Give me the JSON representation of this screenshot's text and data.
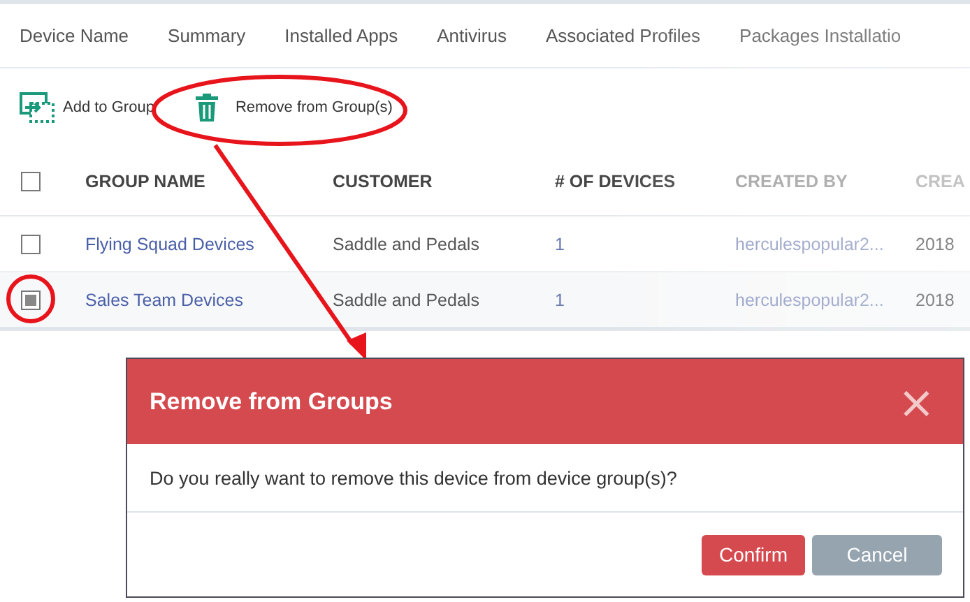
{
  "tabs": [
    {
      "label": "Device Name",
      "selected": false
    },
    {
      "label": "Summary",
      "selected": false
    },
    {
      "label": "Installed Apps",
      "selected": false
    },
    {
      "label": "Antivirus",
      "selected": false
    },
    {
      "label": "Associated Profiles",
      "selected": false
    },
    {
      "label": "Packages Installatio",
      "selected": false
    }
  ],
  "toolbar": [
    {
      "label": "Add to Group",
      "kind": "add"
    },
    {
      "label": "Remove from Group(s)",
      "kind": "remove"
    }
  ],
  "table": {
    "select_all": {
      "checked": false
    },
    "columns": [
      "GROUP NAME",
      "CUSTOMER",
      "# OF DEVICES",
      "CREATED BY",
      "CREA"
    ],
    "rows": [
      {
        "checked": false,
        "cells": [
          "Flying Squad Devices",
          "Saddle and Pedals",
          "1",
          "herculespopular2...",
          "2018"
        ]
      },
      {
        "checked": true,
        "cells": [
          "Sales Team Devices",
          "Saddle and Pedals",
          "1",
          "herculespopular2...",
          "2018"
        ]
      }
    ]
  },
  "dialog": {
    "title": "Remove from Groups",
    "close": "×",
    "message": "Do you really want to remove this device from device group(s)?",
    "buttons": [
      {
        "label": "Confirm",
        "kind": "primary"
      },
      {
        "label": "Cancel",
        "kind": "secondary"
      }
    ]
  }
}
